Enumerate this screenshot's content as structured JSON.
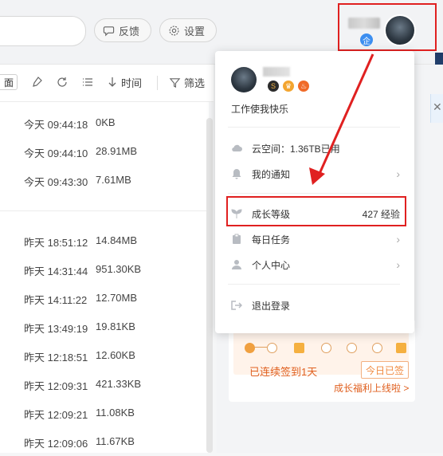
{
  "topbar": {
    "feedback_label": "反馈",
    "settings_label": "设置",
    "vip_badge": "企"
  },
  "toolbar": {
    "first_label": "面",
    "time_label": "时间",
    "filter_label": "筛选"
  },
  "files": [
    {
      "time": "今天 09:44:18",
      "size": "0KB"
    },
    {
      "time": "今天 09:44:10",
      "size": "28.91MB"
    },
    {
      "time": "今天 09:43:30",
      "size": "7.61MB"
    },
    {
      "time": "昨天 18:51:12",
      "size": "14.84MB"
    },
    {
      "time": "昨天 14:31:44",
      "size": "951.30KB"
    },
    {
      "time": "昨天 14:11:22",
      "size": "12.70MB"
    },
    {
      "time": "昨天 13:49:19",
      "size": "19.81KB"
    },
    {
      "time": "昨天 12:18:51",
      "size": "12.60KB"
    },
    {
      "time": "昨天 12:09:31",
      "size": "421.33KB"
    },
    {
      "time": "昨天 12:09:21",
      "size": "11.08KB"
    },
    {
      "time": "昨天 12:09:06",
      "size": "11.67KB"
    }
  ],
  "dropdown": {
    "signature": "工作使我快乐",
    "badges": [
      "S",
      "♛",
      "♨"
    ],
    "cloud_label": "云空间：1.36TB已用",
    "notify_label": "我的通知",
    "growth_label": "成长等级",
    "growth_value": "427 经验",
    "daily_label": "每日任务",
    "profile_label": "个人中心",
    "logout_label": "退出登录"
  },
  "checkin": {
    "streak_text": "已连续签到1天",
    "button_label": "今日已签",
    "link_text": "成长福利上线啦 >"
  },
  "colors": {
    "highlight": "#e02020",
    "accent_orange": "#e06020"
  }
}
